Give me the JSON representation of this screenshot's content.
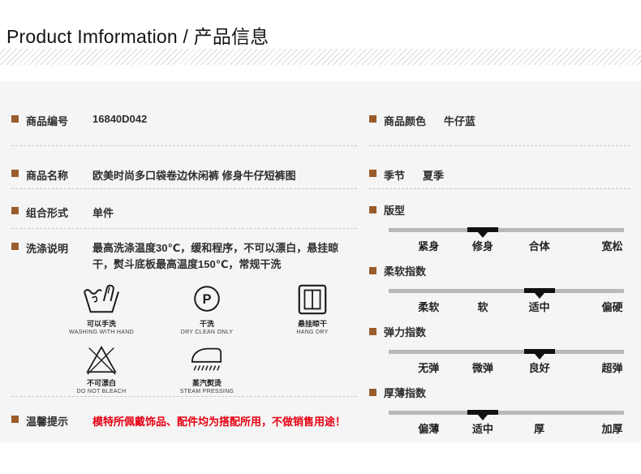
{
  "header": {
    "title": "Product Imformation / 产品信息"
  },
  "left": {
    "rows": [
      {
        "label": "商品编号",
        "value": "16840D042"
      },
      {
        "label": "商品名称",
        "value": "欧美时尚多口袋卷边休闲裤 修身牛仔短裤图"
      },
      {
        "label": "组合形式",
        "value": "单件"
      }
    ],
    "washing": {
      "label": "洗涤说明",
      "value": "最高洗涤温度30℃，缓和程序，不可以漂白，悬挂晾干，熨斗底板最高温度150℃，常规干洗",
      "care_icons": [
        {
          "name": "hand-wash-icon",
          "label_zh": "可以手洗",
          "label_en": "WASHING WITH HAND"
        },
        {
          "name": "dry-clean-icon",
          "label_zh": "干洗",
          "label_en": "DRY CLEAN ONLY",
          "symbol": "P"
        },
        {
          "name": "hang-dry-icon",
          "label_zh": "悬挂晾干",
          "label_en": "HANG DRY"
        },
        {
          "name": "no-bleach-icon",
          "label_zh": "不可漂白",
          "label_en": "DO NOT BLEACH"
        },
        {
          "name": "steam-press-icon",
          "label_zh": "蒸汽熨烫",
          "label_en": "STEAM PRESSING"
        }
      ]
    },
    "tips": {
      "label": "温馨提示",
      "value": "模特所佩戴饰品、配件均为搭配所用，不做销售用途！"
    }
  },
  "right": {
    "rows": [
      {
        "label": "商品颜色",
        "value": "牛仔蓝"
      },
      {
        "label": "季节",
        "value": "夏季"
      }
    ],
    "sliders": [
      {
        "label": "版型",
        "options": [
          "紧身",
          "修身",
          "合体",
          "宽松"
        ],
        "active_index": 1,
        "active_option": "修身"
      },
      {
        "label": "柔软指数",
        "options": [
          "柔软",
          "软",
          "适中",
          "偏硬"
        ],
        "active_index": 2,
        "active_option": "适中"
      },
      {
        "label": "弹力指数",
        "options": [
          "无弹",
          "微弹",
          "良好",
          "超弹"
        ],
        "active_index": 2,
        "active_option": "良好"
      },
      {
        "label": "厚薄指数",
        "options": [
          "偏薄",
          "适中",
          "厚",
          "加厚"
        ],
        "active_index": 1,
        "active_option": "适中"
      }
    ],
    "slider_positions_pct": [
      17,
      40,
      64,
      95
    ]
  },
  "colors": {
    "bullet": "#9a5c2b",
    "tip_red": "#e60012",
    "slider_track": "#b8b8b8",
    "slider_marker": "#111111"
  }
}
